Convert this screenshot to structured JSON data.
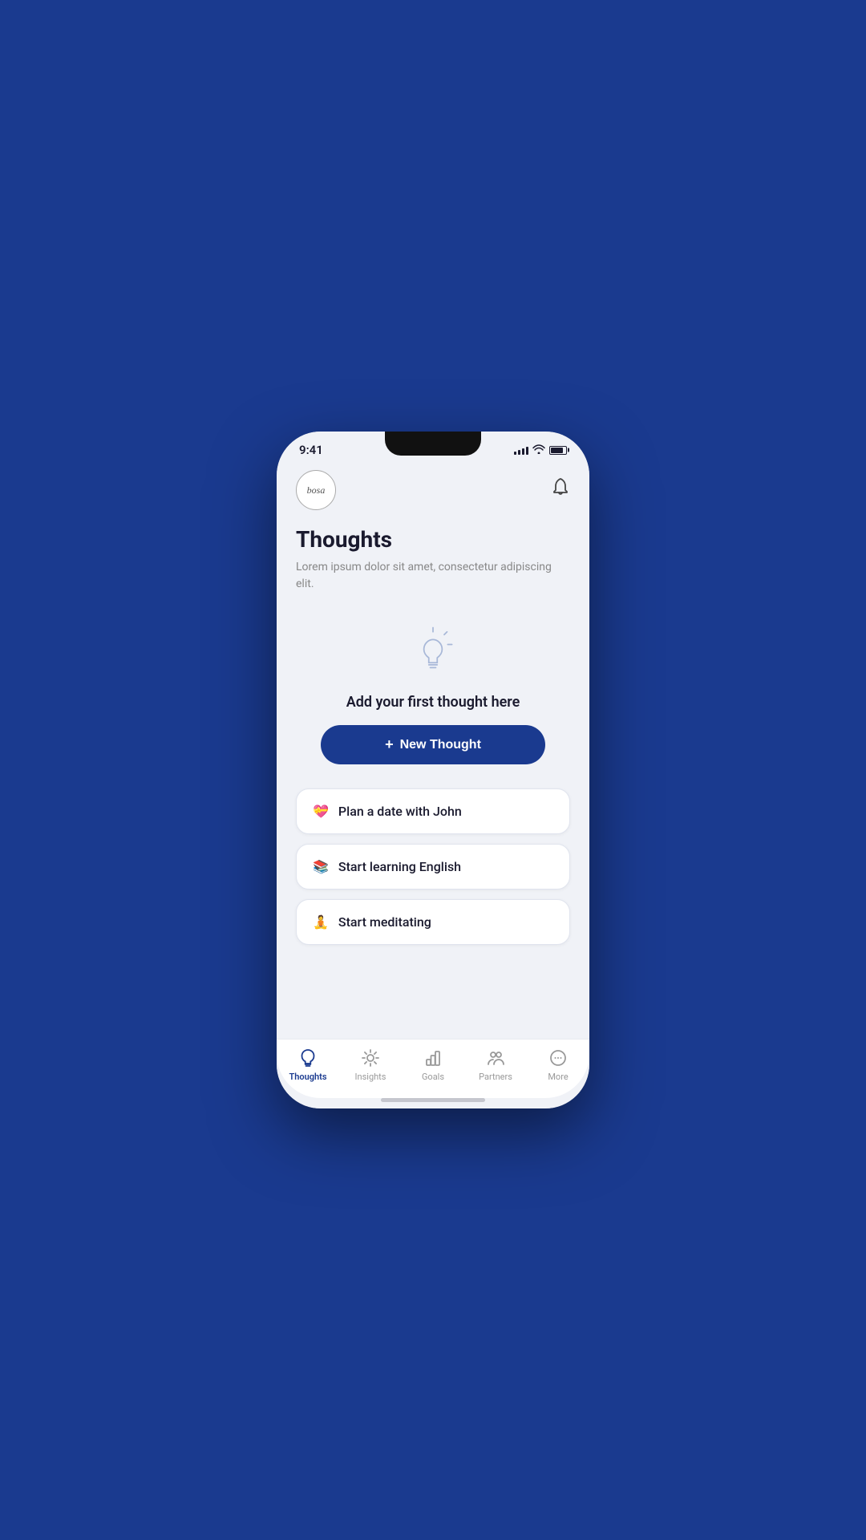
{
  "status": {
    "time": "9:41"
  },
  "header": {
    "logo_text": "bosa",
    "bell_label": "notifications"
  },
  "page": {
    "title": "Thoughts",
    "subtitle": "Lorem ipsum dolor sit amet, consectetur adipiscing elit."
  },
  "empty_state": {
    "message": "Add your first thought here"
  },
  "new_thought_btn": {
    "label": "New Thought",
    "plus": "+"
  },
  "thoughts": [
    {
      "emoji": "💝",
      "text": "Plan a date with John"
    },
    {
      "emoji": "📚",
      "text": "Start learning English"
    },
    {
      "emoji": "🧘",
      "text": "Start meditating"
    }
  ],
  "nav": {
    "items": [
      {
        "id": "thoughts",
        "label": "Thoughts",
        "active": true
      },
      {
        "id": "insights",
        "label": "Insights",
        "active": false
      },
      {
        "id": "goals",
        "label": "Goals",
        "active": false
      },
      {
        "id": "partners",
        "label": "Partners",
        "active": false
      },
      {
        "id": "more",
        "label": "More",
        "active": false
      }
    ]
  }
}
